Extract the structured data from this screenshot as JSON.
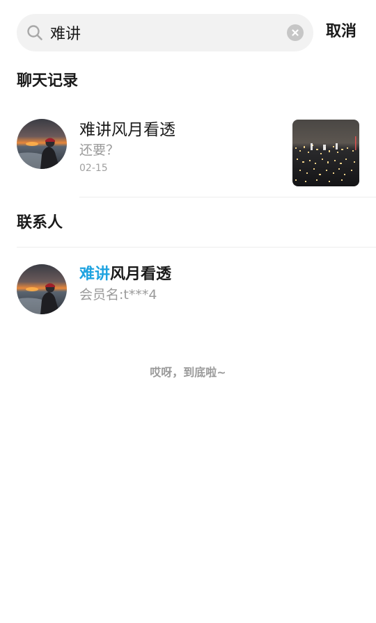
{
  "search": {
    "value": "难讲",
    "cancel_label": "取消"
  },
  "chat_records": {
    "title": "聊天记录",
    "items": [
      {
        "name": "难讲风月看透",
        "snippet": "还要？",
        "date": "02-15"
      }
    ]
  },
  "contacts": {
    "title": "联系人",
    "items": [
      {
        "name_highlight": "难讲",
        "name_rest": "风月看透",
        "member": "会员名:t***4"
      }
    ]
  },
  "footer": {
    "text": "哎呀，到底啦~"
  },
  "colors": {
    "highlight": "#1fa3e0",
    "search_bg": "#f2f2f2",
    "muted_text": "#9a9a9a"
  }
}
